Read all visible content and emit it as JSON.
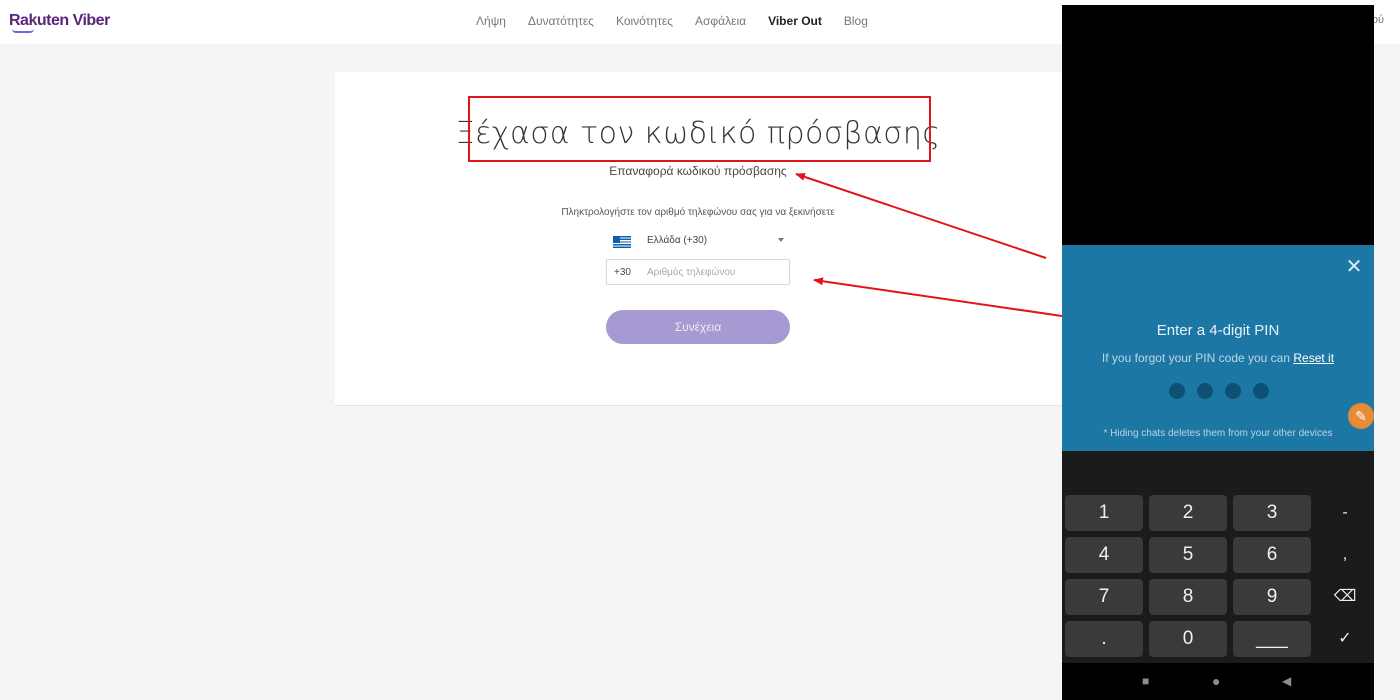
{
  "header": {
    "logo": "Rakuten Viber",
    "nav": [
      "Λήψη",
      "Δυνατότητες",
      "Κοινότητες",
      "Ασφάλεια",
      "Viber Out",
      "Blog"
    ],
    "active_nav": "Viber Out",
    "nav_tail": "ού"
  },
  "form": {
    "title": "Ξέχασα τον κωδικό πρόσβασης",
    "subtitle": "Επαναφορά κωδικού πρόσβασης",
    "instruction": "Πληκτρολογήστε τον αριθμό τηλεφώνου σας για να ξεκινήσετε",
    "country": "Ελλάδα (+30)",
    "prefix": "+30",
    "phone_placeholder": "Αριθμός τηλεφώνου",
    "phone_value": "",
    "continue_label": "Συνέχεια"
  },
  "annotation": {
    "box_color": "#e0151b",
    "arrow_color": "#e0151b"
  },
  "phone_overlay": {
    "pin_title": "Enter a 4-digit PIN",
    "pin_hint": "If you forgot your PIN code you can",
    "pin_reset": "Reset it",
    "pin_note": "* Hiding chats deletes them from your other devices",
    "pin_digits_entered": 0,
    "pin_length": 4,
    "close_icon": "close-icon",
    "fab_icon": "brush-icon",
    "keys": {
      "k1": "1",
      "k2": "2",
      "k3": "3",
      "k4": "4",
      "k5": "5",
      "k6": "6",
      "k7": "7",
      "k8": "8",
      "k9": "9",
      "dot": ".",
      "k0": "0",
      "space": "___"
    },
    "side_keys": {
      "minus": "-",
      "comma": ",",
      "backspace": "⌫",
      "done": "✓"
    },
    "nav_buttons": {
      "recents": "■",
      "home": "●",
      "back": "◀"
    }
  },
  "colors": {
    "brand": "#59267c",
    "button": "#a79ad3",
    "pin_panel": "#1d77a4",
    "keypad": "#1b1b1b"
  }
}
